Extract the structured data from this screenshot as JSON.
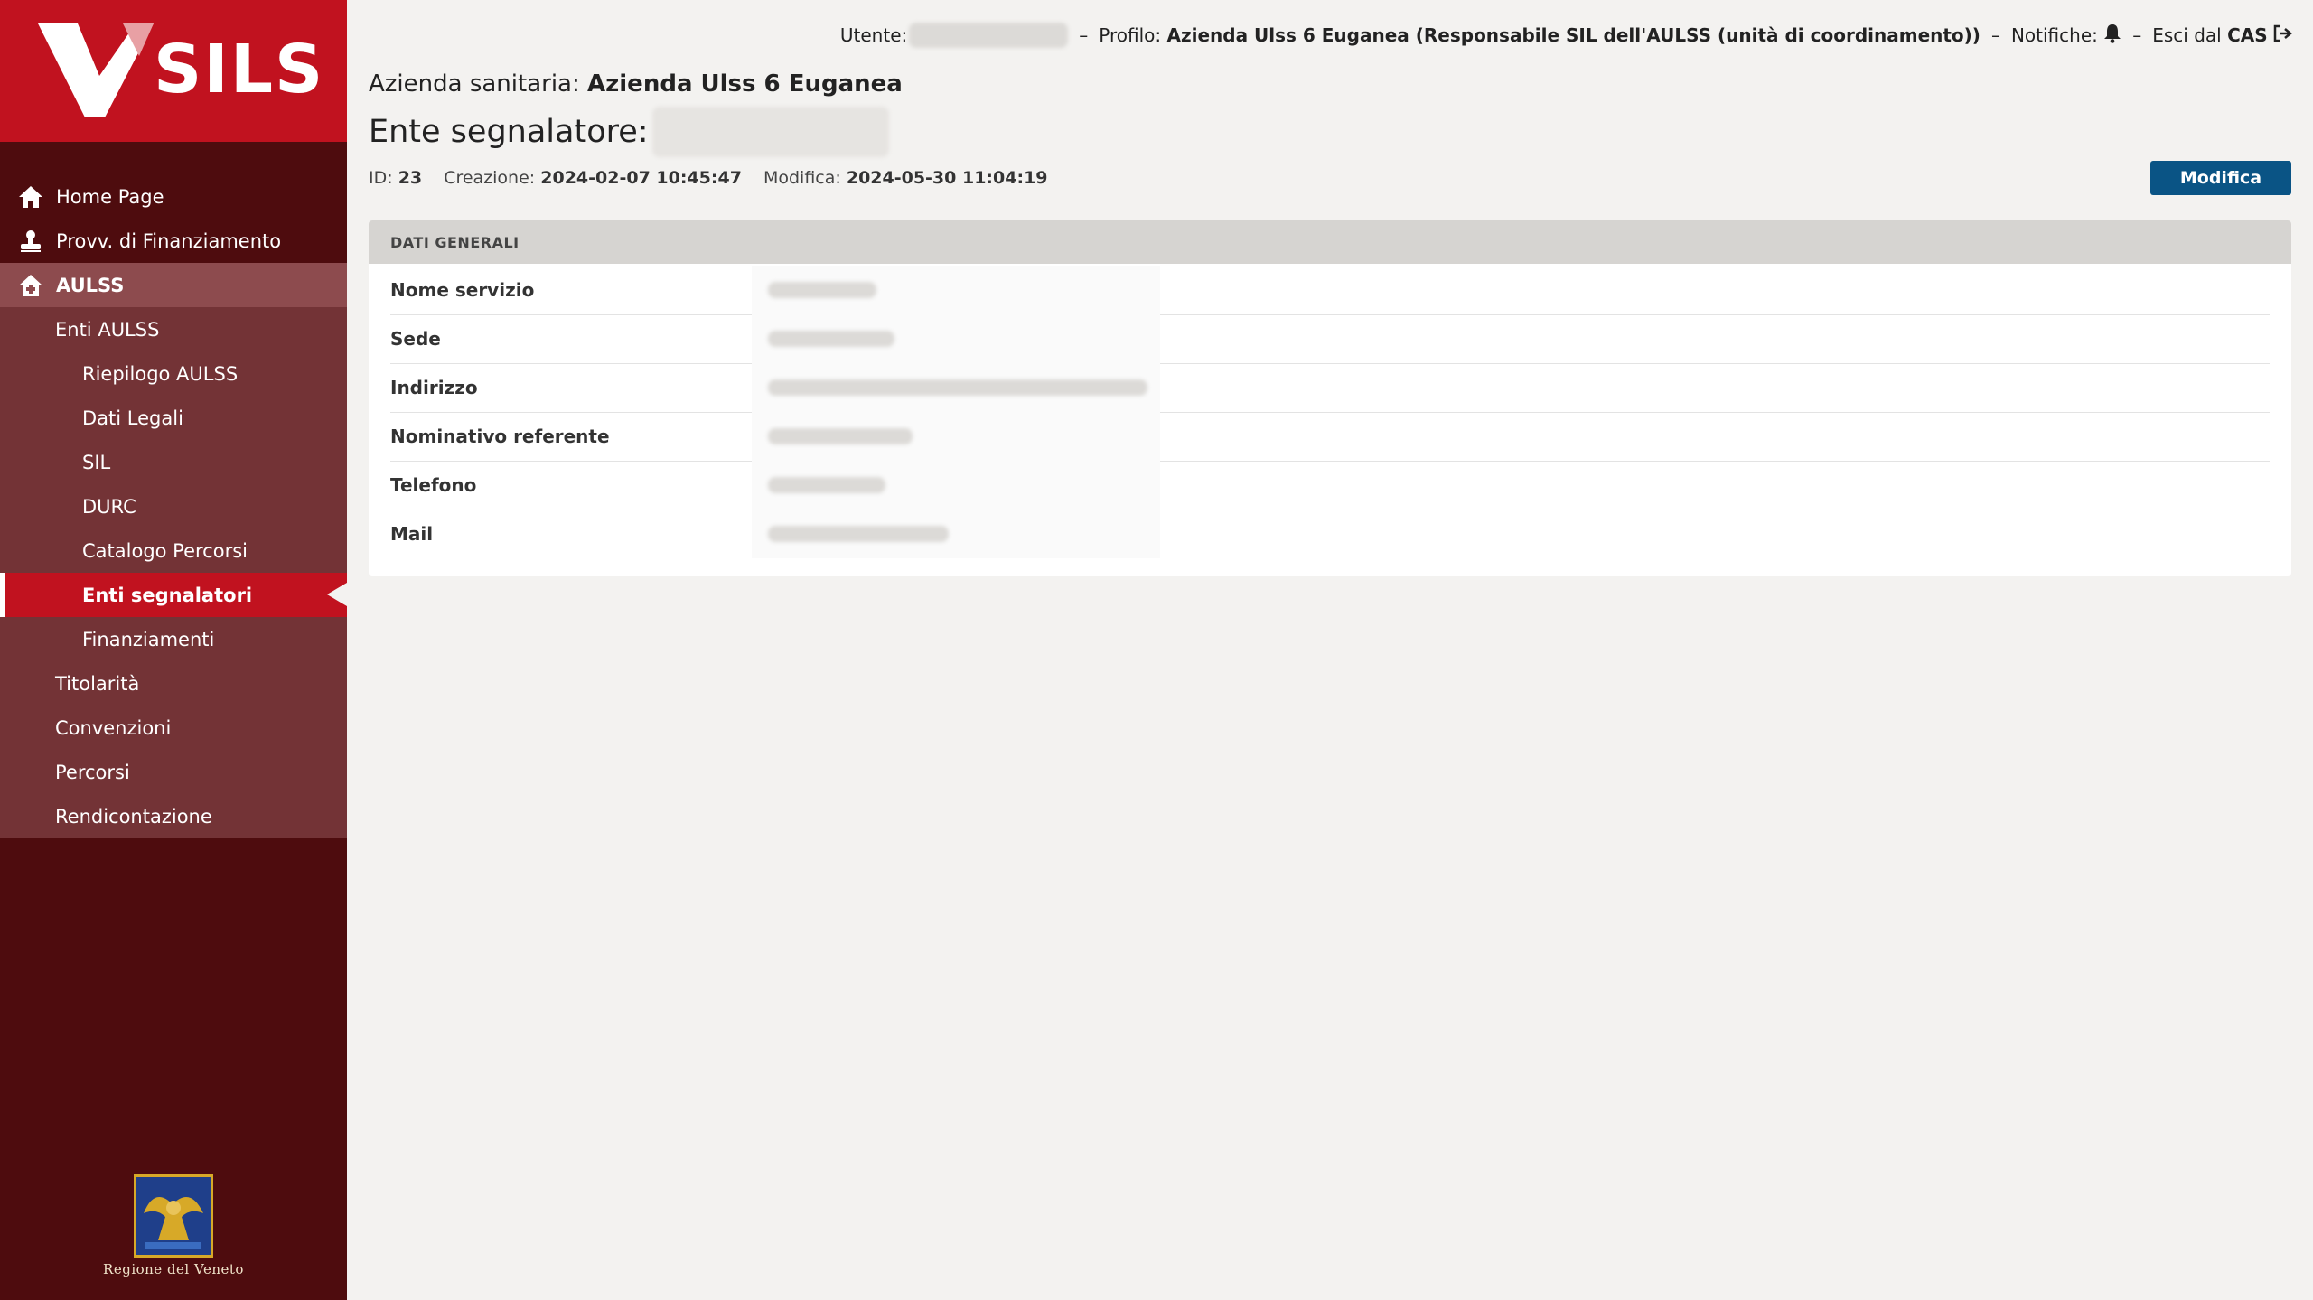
{
  "brand": {
    "name": "SILS",
    "region": "Regione del Veneto"
  },
  "topbar": {
    "user_label": "Utente:",
    "profile_label": "Profilo:",
    "profile_value": "Azienda Ulss 6 Euganea (Responsabile SIL dell'AULSS (unità di coordinamento))",
    "notifications_label": "Notifiche:",
    "logout_label": "Esci dal",
    "logout_bold": "CAS",
    "separator": "–"
  },
  "sidebar": {
    "items": [
      {
        "label": "Home Page",
        "icon": "home-icon"
      },
      {
        "label": "Provv. di Finanziamento",
        "icon": "stamp-icon"
      },
      {
        "label": "AULSS",
        "icon": "hospital-icon"
      }
    ],
    "sub_items": [
      {
        "label": "Enti AULSS"
      },
      {
        "label": "Riepilogo AULSS"
      },
      {
        "label": "Dati Legali"
      },
      {
        "label": "SIL"
      },
      {
        "label": "DURC"
      },
      {
        "label": "Catalogo Percorsi"
      },
      {
        "label": "Enti segnalatori"
      },
      {
        "label": "Finanziamenti"
      },
      {
        "label": "Titolarità"
      },
      {
        "label": "Convenzioni"
      },
      {
        "label": "Percorsi"
      },
      {
        "label": "Rendicontazione"
      }
    ]
  },
  "main": {
    "azienda_label": "Azienda sanitaria:",
    "azienda_value": "Azienda Ulss 6 Euganea",
    "ente_label": "Ente segnalatore:",
    "meta": {
      "id_label": "ID:",
      "id_value": "23",
      "created_label": "Creazione:",
      "created_value": "2024-02-07 10:45:47",
      "modified_label": "Modifica:",
      "modified_value": "2024-05-30 11:04:19"
    },
    "edit_button": "Modifica",
    "panel_title": "DATI GENERALI",
    "fields": [
      {
        "label": "Nome servizio"
      },
      {
        "label": "Sede"
      },
      {
        "label": "Indirizzo"
      },
      {
        "label": "Nominativo referente"
      },
      {
        "label": "Telefono"
      },
      {
        "label": "Mail"
      }
    ]
  },
  "colors": {
    "brand_red": "#c1121f",
    "sidebar_dark": "#4e0c0e",
    "sidebar_section": "#733336",
    "button_blue": "#0a5485"
  }
}
